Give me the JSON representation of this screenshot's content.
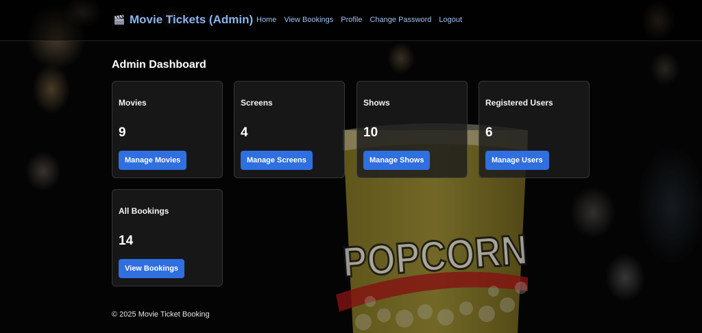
{
  "app": {
    "brand_title": "Movie Tickets (Admin)",
    "brand_icon": "clapperboard-icon"
  },
  "nav": {
    "items": [
      "Home",
      "View Bookings",
      "Profile",
      "Change Password",
      "Logout"
    ]
  },
  "dashboard": {
    "title": "Admin Dashboard",
    "cards": [
      {
        "title": "Movies",
        "count": "9",
        "button": "Manage Movies"
      },
      {
        "title": "Screens",
        "count": "4",
        "button": "Manage Screens"
      },
      {
        "title": "Shows",
        "count": "10",
        "button": "Manage Shows"
      },
      {
        "title": "Registered Users",
        "count": "6",
        "button": "Manage Users"
      },
      {
        "title": "All Bookings",
        "count": "14",
        "button": "View Bookings"
      }
    ]
  },
  "background": {
    "popcorn_text": "POPCORN"
  },
  "footer": {
    "text": "© 2025 Movie Ticket Booking"
  },
  "colors": {
    "accent": "#2f6fe0",
    "link": "#9ec2f2",
    "brand": "#8ab4f0"
  }
}
